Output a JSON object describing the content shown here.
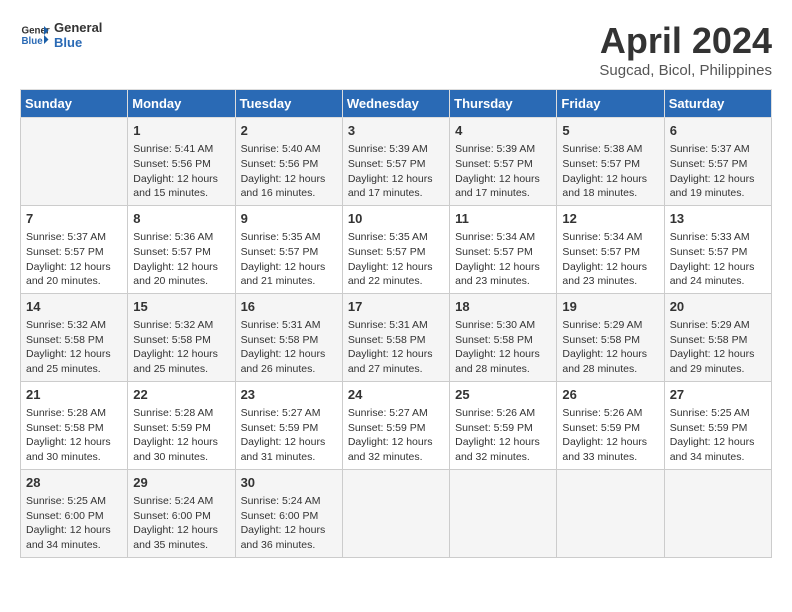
{
  "header": {
    "logo_line1": "General",
    "logo_line2": "Blue",
    "month_year": "April 2024",
    "location": "Sugcad, Bicol, Philippines"
  },
  "days_of_week": [
    "Sunday",
    "Monday",
    "Tuesday",
    "Wednesday",
    "Thursday",
    "Friday",
    "Saturday"
  ],
  "weeks": [
    [
      {
        "num": "",
        "info": ""
      },
      {
        "num": "1",
        "info": "Sunrise: 5:41 AM\nSunset: 5:56 PM\nDaylight: 12 hours\nand 15 minutes."
      },
      {
        "num": "2",
        "info": "Sunrise: 5:40 AM\nSunset: 5:56 PM\nDaylight: 12 hours\nand 16 minutes."
      },
      {
        "num": "3",
        "info": "Sunrise: 5:39 AM\nSunset: 5:57 PM\nDaylight: 12 hours\nand 17 minutes."
      },
      {
        "num": "4",
        "info": "Sunrise: 5:39 AM\nSunset: 5:57 PM\nDaylight: 12 hours\nand 17 minutes."
      },
      {
        "num": "5",
        "info": "Sunrise: 5:38 AM\nSunset: 5:57 PM\nDaylight: 12 hours\nand 18 minutes."
      },
      {
        "num": "6",
        "info": "Sunrise: 5:37 AM\nSunset: 5:57 PM\nDaylight: 12 hours\nand 19 minutes."
      }
    ],
    [
      {
        "num": "7",
        "info": "Sunrise: 5:37 AM\nSunset: 5:57 PM\nDaylight: 12 hours\nand 20 minutes."
      },
      {
        "num": "8",
        "info": "Sunrise: 5:36 AM\nSunset: 5:57 PM\nDaylight: 12 hours\nand 20 minutes."
      },
      {
        "num": "9",
        "info": "Sunrise: 5:35 AM\nSunset: 5:57 PM\nDaylight: 12 hours\nand 21 minutes."
      },
      {
        "num": "10",
        "info": "Sunrise: 5:35 AM\nSunset: 5:57 PM\nDaylight: 12 hours\nand 22 minutes."
      },
      {
        "num": "11",
        "info": "Sunrise: 5:34 AM\nSunset: 5:57 PM\nDaylight: 12 hours\nand 23 minutes."
      },
      {
        "num": "12",
        "info": "Sunrise: 5:34 AM\nSunset: 5:57 PM\nDaylight: 12 hours\nand 23 minutes."
      },
      {
        "num": "13",
        "info": "Sunrise: 5:33 AM\nSunset: 5:57 PM\nDaylight: 12 hours\nand 24 minutes."
      }
    ],
    [
      {
        "num": "14",
        "info": "Sunrise: 5:32 AM\nSunset: 5:58 PM\nDaylight: 12 hours\nand 25 minutes."
      },
      {
        "num": "15",
        "info": "Sunrise: 5:32 AM\nSunset: 5:58 PM\nDaylight: 12 hours\nand 25 minutes."
      },
      {
        "num": "16",
        "info": "Sunrise: 5:31 AM\nSunset: 5:58 PM\nDaylight: 12 hours\nand 26 minutes."
      },
      {
        "num": "17",
        "info": "Sunrise: 5:31 AM\nSunset: 5:58 PM\nDaylight: 12 hours\nand 27 minutes."
      },
      {
        "num": "18",
        "info": "Sunrise: 5:30 AM\nSunset: 5:58 PM\nDaylight: 12 hours\nand 28 minutes."
      },
      {
        "num": "19",
        "info": "Sunrise: 5:29 AM\nSunset: 5:58 PM\nDaylight: 12 hours\nand 28 minutes."
      },
      {
        "num": "20",
        "info": "Sunrise: 5:29 AM\nSunset: 5:58 PM\nDaylight: 12 hours\nand 29 minutes."
      }
    ],
    [
      {
        "num": "21",
        "info": "Sunrise: 5:28 AM\nSunset: 5:58 PM\nDaylight: 12 hours\nand 30 minutes."
      },
      {
        "num": "22",
        "info": "Sunrise: 5:28 AM\nSunset: 5:59 PM\nDaylight: 12 hours\nand 30 minutes."
      },
      {
        "num": "23",
        "info": "Sunrise: 5:27 AM\nSunset: 5:59 PM\nDaylight: 12 hours\nand 31 minutes."
      },
      {
        "num": "24",
        "info": "Sunrise: 5:27 AM\nSunset: 5:59 PM\nDaylight: 12 hours\nand 32 minutes."
      },
      {
        "num": "25",
        "info": "Sunrise: 5:26 AM\nSunset: 5:59 PM\nDaylight: 12 hours\nand 32 minutes."
      },
      {
        "num": "26",
        "info": "Sunrise: 5:26 AM\nSunset: 5:59 PM\nDaylight: 12 hours\nand 33 minutes."
      },
      {
        "num": "27",
        "info": "Sunrise: 5:25 AM\nSunset: 5:59 PM\nDaylight: 12 hours\nand 34 minutes."
      }
    ],
    [
      {
        "num": "28",
        "info": "Sunrise: 5:25 AM\nSunset: 6:00 PM\nDaylight: 12 hours\nand 34 minutes."
      },
      {
        "num": "29",
        "info": "Sunrise: 5:24 AM\nSunset: 6:00 PM\nDaylight: 12 hours\nand 35 minutes."
      },
      {
        "num": "30",
        "info": "Sunrise: 5:24 AM\nSunset: 6:00 PM\nDaylight: 12 hours\nand 36 minutes."
      },
      {
        "num": "",
        "info": ""
      },
      {
        "num": "",
        "info": ""
      },
      {
        "num": "",
        "info": ""
      },
      {
        "num": "",
        "info": ""
      }
    ]
  ]
}
